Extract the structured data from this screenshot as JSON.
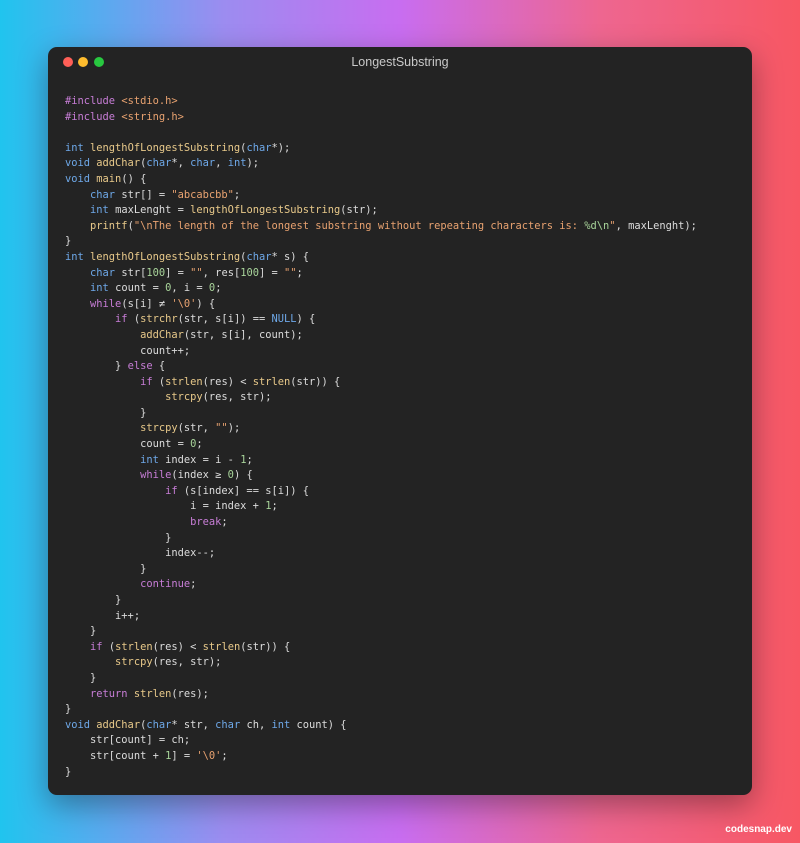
{
  "window": {
    "title": "LongestSubstring"
  },
  "code": {
    "lines": [
      [
        [
          "pp",
          "#include "
        ],
        [
          "str",
          "<stdio.h>"
        ]
      ],
      [
        [
          "pp",
          "#include "
        ],
        [
          "str",
          "<string.h>"
        ]
      ],
      [],
      [
        [
          "ty",
          "int "
        ],
        [
          "fn",
          "lengthOfLongestSubstring"
        ],
        [
          "",
          "("
        ],
        [
          "ty",
          "char"
        ],
        [
          "",
          "*);"
        ]
      ],
      [
        [
          "ty",
          "void "
        ],
        [
          "fn",
          "addChar"
        ],
        [
          "",
          "("
        ],
        [
          "ty",
          "char"
        ],
        [
          "",
          "*, "
        ],
        [
          "ty",
          "char"
        ],
        [
          "",
          ", "
        ],
        [
          "ty",
          "int"
        ],
        [
          "",
          ");"
        ]
      ],
      [
        [
          "ty",
          "void "
        ],
        [
          "fn",
          "main"
        ],
        [
          "",
          "() {"
        ]
      ],
      [
        [
          "",
          "    "
        ],
        [
          "ty",
          "char "
        ],
        [
          "",
          "str[] = "
        ],
        [
          "str",
          "\"abcabcbb\""
        ],
        [
          "",
          ";"
        ]
      ],
      [
        [
          "",
          "    "
        ],
        [
          "ty",
          "int "
        ],
        [
          "",
          "maxLenght = "
        ],
        [
          "fn",
          "lengthOfLongestSubstring"
        ],
        [
          "",
          "(str);"
        ]
      ],
      [
        [
          "",
          "    "
        ],
        [
          "fn",
          "printf"
        ],
        [
          "",
          "("
        ],
        [
          "str",
          "\"\\nThe length of the longest substring without repeating characters is: "
        ],
        [
          "num",
          "%d\\n"
        ],
        [
          "str",
          "\""
        ],
        [
          "",
          ", maxLenght);"
        ]
      ],
      [
        [
          "",
          "}"
        ]
      ],
      [
        [
          "ty",
          "int "
        ],
        [
          "fn",
          "lengthOfLongestSubstring"
        ],
        [
          "",
          "("
        ],
        [
          "ty",
          "char"
        ],
        [
          "",
          "* s) {"
        ]
      ],
      [
        [
          "",
          "    "
        ],
        [
          "ty",
          "char "
        ],
        [
          "",
          "str["
        ],
        [
          "num",
          "100"
        ],
        [
          "",
          "] = "
        ],
        [
          "str",
          "\"\""
        ],
        [
          "",
          ", res["
        ],
        [
          "num",
          "100"
        ],
        [
          "",
          "] = "
        ],
        [
          "str",
          "\"\""
        ],
        [
          "",
          ";"
        ]
      ],
      [
        [
          "",
          "    "
        ],
        [
          "ty",
          "int "
        ],
        [
          "",
          "count = "
        ],
        [
          "num",
          "0"
        ],
        [
          "",
          ", i = "
        ],
        [
          "num",
          "0"
        ],
        [
          "",
          ";"
        ]
      ],
      [
        [
          "",
          "    "
        ],
        [
          "kw",
          "while"
        ],
        [
          "",
          "(s[i] ≠ "
        ],
        [
          "str",
          "'\\0'"
        ],
        [
          "",
          ") {"
        ]
      ],
      [
        [
          "",
          "        "
        ],
        [
          "kw",
          "if "
        ],
        [
          "",
          "("
        ],
        [
          "fn",
          "strchr"
        ],
        [
          "",
          "(str, s[i]) == "
        ],
        [
          "ty",
          "NULL"
        ],
        [
          "",
          ") {"
        ]
      ],
      [
        [
          "",
          "            "
        ],
        [
          "fn",
          "addChar"
        ],
        [
          "",
          "(str, s[i], count);"
        ]
      ],
      [
        [
          "",
          "            count++;"
        ]
      ],
      [
        [
          "",
          "        } "
        ],
        [
          "kw",
          "else"
        ],
        [
          "",
          " {"
        ]
      ],
      [
        [
          "",
          "            "
        ],
        [
          "kw",
          "if "
        ],
        [
          "",
          "("
        ],
        [
          "fn",
          "strlen"
        ],
        [
          "",
          "(res) < "
        ],
        [
          "fn",
          "strlen"
        ],
        [
          "",
          "(str)) {"
        ]
      ],
      [
        [
          "",
          "                "
        ],
        [
          "fn",
          "strcpy"
        ],
        [
          "",
          "(res, str);"
        ]
      ],
      [
        [
          "",
          "            }"
        ]
      ],
      [
        [
          "",
          "            "
        ],
        [
          "fn",
          "strcpy"
        ],
        [
          "",
          "(str, "
        ],
        [
          "str",
          "\"\""
        ],
        [
          "",
          ");"
        ]
      ],
      [
        [
          "",
          "            count = "
        ],
        [
          "num",
          "0"
        ],
        [
          "",
          ";"
        ]
      ],
      [
        [
          "",
          "            "
        ],
        [
          "ty",
          "int "
        ],
        [
          "",
          "index = i - "
        ],
        [
          "num",
          "1"
        ],
        [
          "",
          ";"
        ]
      ],
      [
        [
          "",
          "            "
        ],
        [
          "kw",
          "while"
        ],
        [
          "",
          "(index ≥ "
        ],
        [
          "num",
          "0"
        ],
        [
          "",
          ") {"
        ]
      ],
      [
        [
          "",
          "                "
        ],
        [
          "kw",
          "if "
        ],
        [
          "",
          "(s[index] == s[i]) {"
        ]
      ],
      [
        [
          "",
          "                    i = index + "
        ],
        [
          "num",
          "1"
        ],
        [
          "",
          ";"
        ]
      ],
      [
        [
          "",
          "                    "
        ],
        [
          "kw",
          "break"
        ],
        [
          "",
          ";"
        ]
      ],
      [
        [
          "",
          "                }"
        ]
      ],
      [
        [
          "",
          "                index--;"
        ]
      ],
      [
        [
          "",
          "            }"
        ]
      ],
      [
        [
          "",
          "            "
        ],
        [
          "kw",
          "continue"
        ],
        [
          "",
          ";"
        ]
      ],
      [
        [
          "",
          "        }"
        ]
      ],
      [
        [
          "",
          "        i++;"
        ]
      ],
      [
        [
          "",
          "    }"
        ]
      ],
      [
        [
          "",
          "    "
        ],
        [
          "kw",
          "if "
        ],
        [
          "",
          "("
        ],
        [
          "fn",
          "strlen"
        ],
        [
          "",
          "(res) < "
        ],
        [
          "fn",
          "strlen"
        ],
        [
          "",
          "(str)) {"
        ]
      ],
      [
        [
          "",
          "        "
        ],
        [
          "fn",
          "strcpy"
        ],
        [
          "",
          "(res, str);"
        ]
      ],
      [
        [
          "",
          "    }"
        ]
      ],
      [
        [
          "",
          "    "
        ],
        [
          "kw",
          "return "
        ],
        [
          "fn",
          "strlen"
        ],
        [
          "",
          "(res);"
        ]
      ],
      [
        [
          "",
          "}"
        ]
      ],
      [
        [
          "ty",
          "void "
        ],
        [
          "fn",
          "addChar"
        ],
        [
          "",
          "("
        ],
        [
          "ty",
          "char"
        ],
        [
          "",
          "* str, "
        ],
        [
          "ty",
          "char "
        ],
        [
          "",
          "ch, "
        ],
        [
          "ty",
          "int "
        ],
        [
          "",
          "count) {"
        ]
      ],
      [
        [
          "",
          "    str[count] = ch;"
        ]
      ],
      [
        [
          "",
          "    str[count + "
        ],
        [
          "num",
          "1"
        ],
        [
          "",
          "] = "
        ],
        [
          "str",
          "'\\0'"
        ],
        [
          "",
          ";"
        ]
      ],
      [
        [
          "",
          "}"
        ]
      ]
    ]
  },
  "watermark": {
    "text": "codesnap.dev"
  },
  "colors": {
    "window_bg": "#232323",
    "keyword": "#c77dd6",
    "type": "#6ea8e8",
    "function": "#e8c98a",
    "string": "#e8a270",
    "number": "#a8d49a"
  }
}
